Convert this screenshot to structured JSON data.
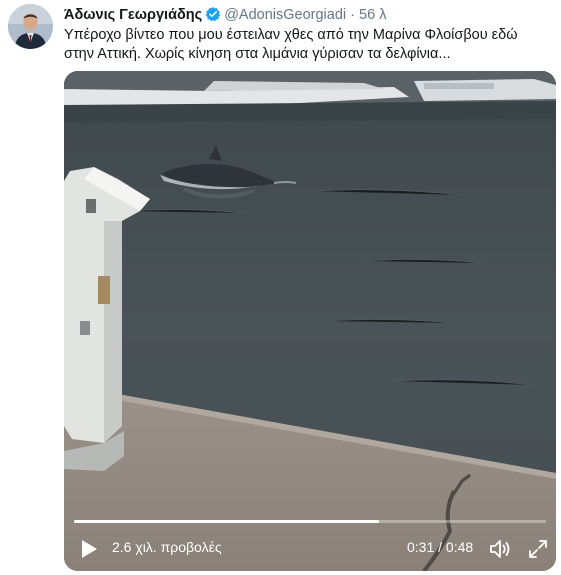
{
  "tweet": {
    "author": {
      "name": "Άδωνις Γεωργιάδης",
      "handle": "@AdonisGeorgiadi",
      "separator": "·",
      "time": "56 λ",
      "verified": true
    },
    "text_line1": "Υπέροχο βίντεο που μου έστειλαν χθες από την Μαρίνα Φλοίσβου εδώ",
    "text_line2": "στην Αττική. Χωρίς κίνηση στα λιμάνια γύρισαν τα δελφίνια..."
  },
  "video": {
    "views": "2.6 χιλ. προβολές",
    "timer": "0:31 / 0:48",
    "progress": 0.646,
    "icons": [
      "play-icon",
      "volume-icon",
      "fullscreen-icon"
    ]
  },
  "colors": {
    "verified": "#1da1f2",
    "text": "#14171a",
    "muted": "#657786"
  }
}
